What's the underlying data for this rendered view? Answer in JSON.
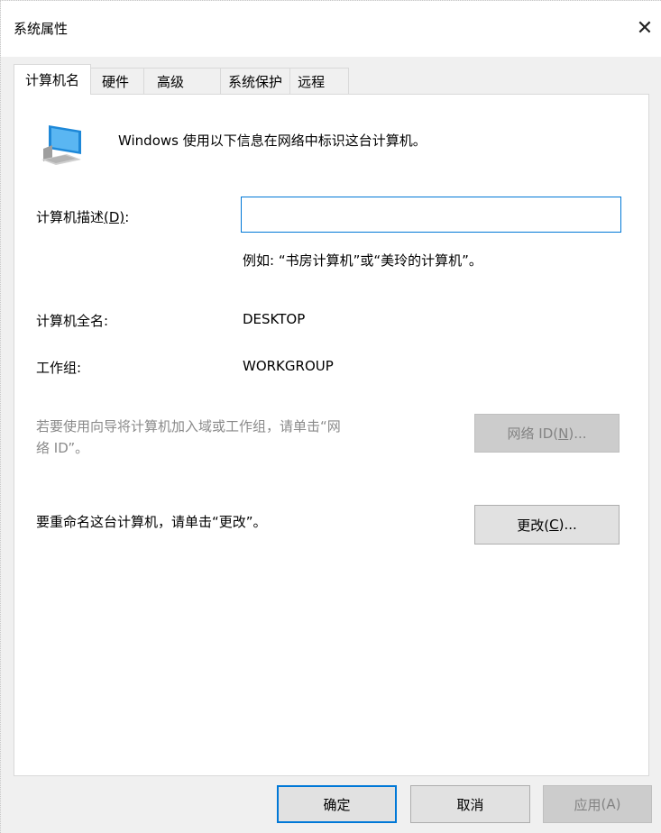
{
  "window": {
    "title": "系统属性",
    "close_glyph": "✕"
  },
  "tabs": [
    {
      "label": "计算机名",
      "active": true
    },
    {
      "label": "硬件",
      "active": false
    },
    {
      "label": "高级",
      "active": false
    },
    {
      "label": "系统保护",
      "active": false
    },
    {
      "label": "远程",
      "active": false
    }
  ],
  "computer_name_tab": {
    "intro": "Windows 使用以下信息在网络中标识这台计算机。",
    "description_label": "计算机描述",
    "description_accel": "(D)",
    "description_suffix": ":",
    "description_value": "",
    "example": "例如: “书房计算机”或“美玲的计算机”。",
    "full_name_label": "计算机全名:",
    "full_name_value": "DESKTOP",
    "workgroup_label": "工作组:",
    "workgroup_value": "WORKGROUP",
    "domain_hint_line1": "若要使用向导将计算机加入域或工作组，请单击“网",
    "domain_hint_line2": "络 ID”。",
    "network_id_button": {
      "label": "网络 ID(",
      "accel": "N",
      "suffix": ")..."
    },
    "rename_hint": "要重命名这台计算机，请单击“更改”。",
    "change_button": {
      "label": "更改(",
      "accel": "C",
      "suffix": ")..."
    }
  },
  "footer": {
    "ok_label": "确定",
    "cancel_label": "取消",
    "apply_label": "应用",
    "apply_accel": "(A)"
  },
  "colors": {
    "accent": "#0078d7",
    "dialog_bg": "#f0f0f0",
    "panel_bg": "#ffffff",
    "disabled_text": "#838383"
  },
  "icons": {
    "computer": "computer-icon",
    "close": "close-icon"
  }
}
